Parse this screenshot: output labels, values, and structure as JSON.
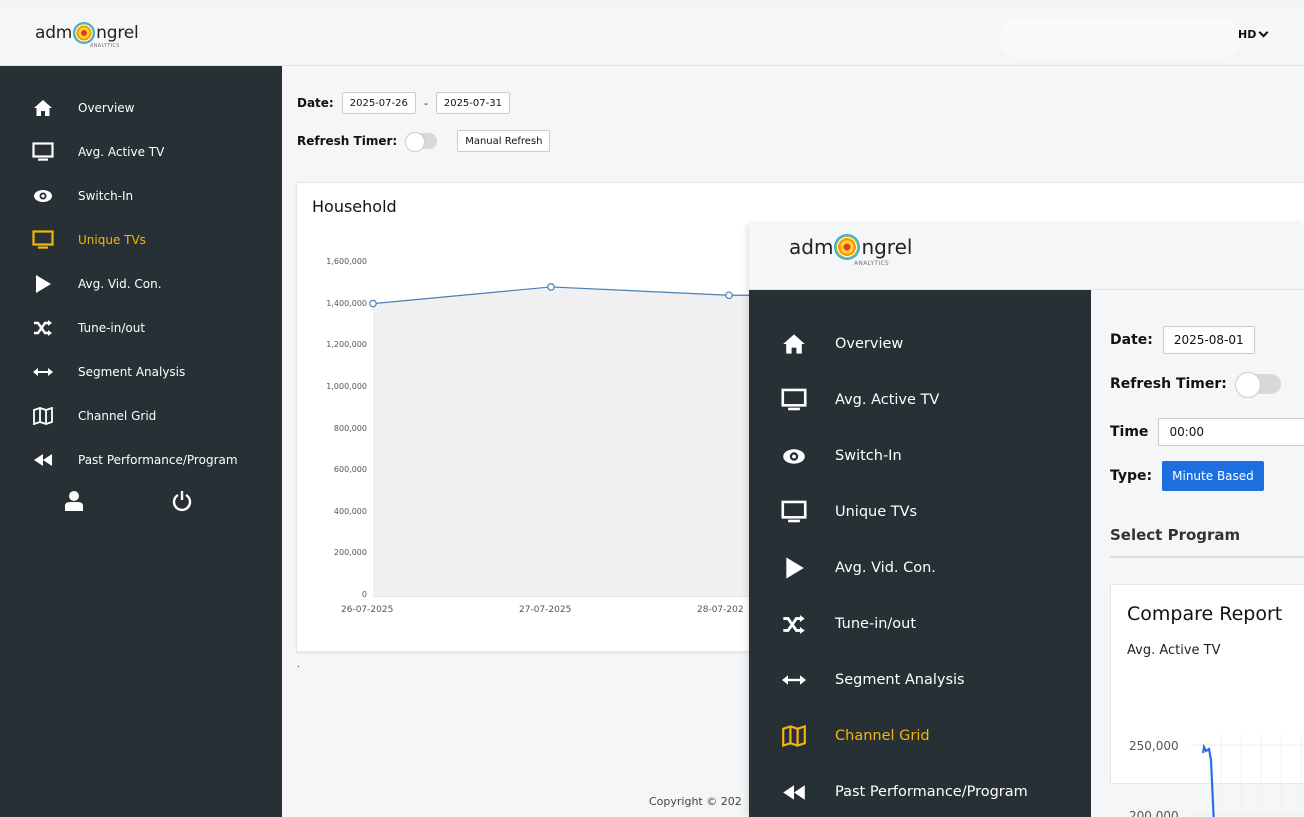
{
  "back": {
    "logo": {
      "pre": "adm",
      "post": "ngrel",
      "sub": "ANALYTICS"
    },
    "user_menu": "HD",
    "nav": [
      {
        "label": "Overview",
        "icon": "home-icon"
      },
      {
        "label": "Avg. Active TV",
        "icon": "monitor-icon"
      },
      {
        "label": "Switch-In",
        "icon": "eye-icon"
      },
      {
        "label": "Unique TVs",
        "icon": "monitor-icon",
        "active": true
      },
      {
        "label": "Avg. Vid. Con.",
        "icon": "play-icon"
      },
      {
        "label": "Tune-in/out",
        "icon": "shuffle-icon"
      },
      {
        "label": "Segment Analysis",
        "icon": "arrows-horizontal-icon"
      },
      {
        "label": "Channel Grid",
        "icon": "map-icon"
      },
      {
        "label": "Past Performance/Program",
        "icon": "rewind-icon"
      }
    ],
    "date_label": "Date:",
    "date_from": "2025-07-26",
    "date_sep": "-",
    "date_to": "2025-07-31",
    "refresh_label": "Refresh Timer:",
    "manual_refresh": "Manual Refresh",
    "card_title": "Household",
    "dot": ".",
    "copyright": "Copyright © 202"
  },
  "chart_data": {
    "type": "area",
    "title": "Household",
    "x": [
      "26-07-2025",
      "27-07-2025",
      "28-07-202"
    ],
    "series": [
      {
        "values": [
          1405000,
          1485000,
          1445000
        ]
      }
    ],
    "y_ticks": [
      "1,600,000",
      "1,400,000",
      "1,200,000",
      "1,000,000",
      "800,000",
      "600,000",
      "400,000",
      "200,000",
      "0"
    ],
    "ylim": [
      0,
      1600000
    ],
    "grid": false,
    "line_color": "#4a7fb5",
    "fill_color": "#f0f0f0"
  },
  "front": {
    "logo": {
      "pre": "adm",
      "post": "ngrel",
      "sub": "ANALYTICS"
    },
    "nav": [
      {
        "label": "Overview",
        "icon": "home-icon"
      },
      {
        "label": "Avg. Active TV",
        "icon": "monitor-icon"
      },
      {
        "label": "Switch-In",
        "icon": "eye-icon"
      },
      {
        "label": "Unique TVs",
        "icon": "monitor-icon"
      },
      {
        "label": "Avg. Vid. Con.",
        "icon": "play-icon"
      },
      {
        "label": "Tune-in/out",
        "icon": "shuffle-icon"
      },
      {
        "label": "Segment Analysis",
        "icon": "arrows-horizontal-icon"
      },
      {
        "label": "Channel Grid",
        "icon": "map-icon",
        "active": true
      },
      {
        "label": "Past Performance/Program",
        "icon": "rewind-icon"
      }
    ],
    "date_label": "Date:",
    "date_value": "2025-08-01",
    "refresh_label": "Refresh Timer:",
    "time_label": "Time",
    "time_value": "00:00",
    "type_label": "Type:",
    "type_button": "Minute Based",
    "select_program": "Select Program",
    "card_title": "Compare Report",
    "card_subtitle": "Avg. Active TV",
    "tick_250": "250,000",
    "tick_200": "200,000"
  },
  "colors": {
    "sidebar": "#263035",
    "active": "#f5b50a",
    "primary": "#1d6fe0"
  }
}
